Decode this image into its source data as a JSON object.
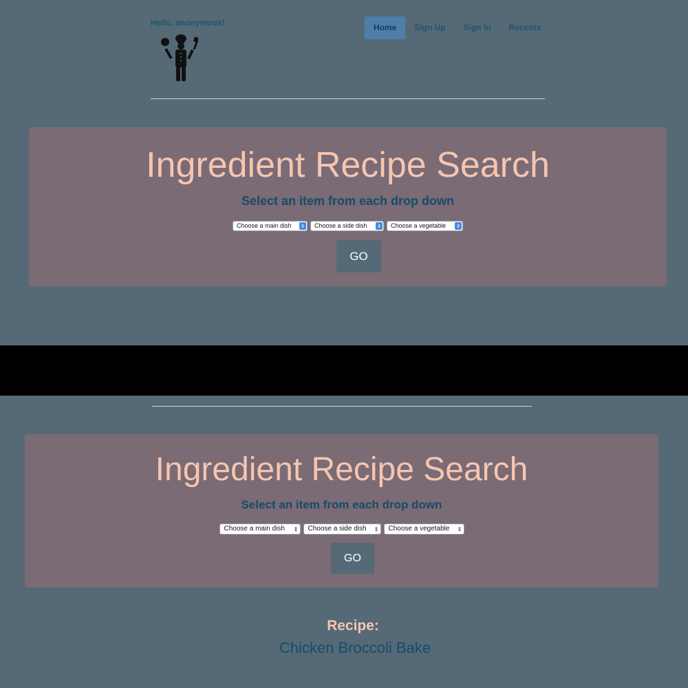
{
  "header": {
    "greeting": "Hello, anonymous!",
    "logo_icon": "chef-icon",
    "nav": [
      {
        "label": "Home",
        "active": true
      },
      {
        "label": "Sign Up",
        "active": false
      },
      {
        "label": "Sign In",
        "active": false
      },
      {
        "label": "Recents",
        "active": false
      }
    ]
  },
  "search": {
    "title": "Ingredient Recipe Search",
    "subtitle": "Select an item from each drop down",
    "main_dish_select": "Choose a main dish",
    "side_dish_select": "Choose a side dish",
    "vegetable_select": "Choose a vegetable",
    "go_label": "GO"
  },
  "result": {
    "label": "Recipe:",
    "name": "Chicken Broccoli Bake"
  },
  "colors": {
    "background": "#556a76",
    "panel": "#7a6b75",
    "title": "#f6c5b0",
    "accent": "#4e7faa"
  }
}
